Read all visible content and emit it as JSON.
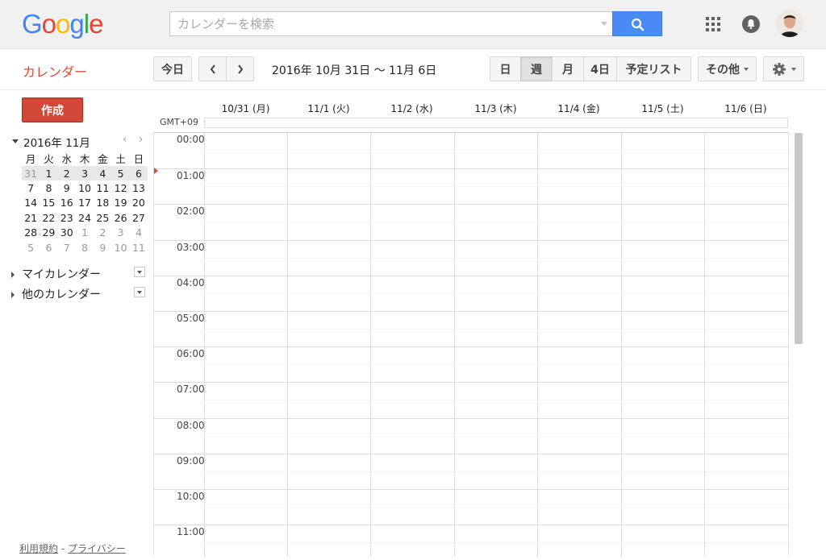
{
  "logo": {
    "text": "Google"
  },
  "search": {
    "placeholder": "カレンダーを検索"
  },
  "app": {
    "title": "カレンダー"
  },
  "toolbar": {
    "today_label": "今日",
    "prev": "‹",
    "next": "›",
    "date_range": "2016年 10月 31日 〜 11月 6日",
    "views": [
      "日",
      "週",
      "月",
      "4日",
      "予定リスト"
    ],
    "active_view": "週",
    "more_label": "その他",
    "settings_icon": "gear-icon"
  },
  "sidebar": {
    "create_label": "作成",
    "mini_month": "2016年 11月",
    "weekday_headers": [
      "月",
      "火",
      "水",
      "木",
      "金",
      "土",
      "日"
    ],
    "weeks": [
      [
        "31",
        "1",
        "2",
        "3",
        "4",
        "5",
        "6"
      ],
      [
        "7",
        "8",
        "9",
        "10",
        "11",
        "12",
        "13"
      ],
      [
        "14",
        "15",
        "16",
        "17",
        "18",
        "19",
        "20"
      ],
      [
        "21",
        "22",
        "23",
        "24",
        "25",
        "26",
        "27"
      ],
      [
        "28",
        "29",
        "30",
        "1",
        "2",
        "3",
        "4"
      ],
      [
        "5",
        "6",
        "7",
        "8",
        "9",
        "10",
        "11"
      ]
    ],
    "my_calendars": "マイカレンダー",
    "other_calendars": "他のカレンダー"
  },
  "grid": {
    "timezone": "GMT+09",
    "days": [
      "10/31 (月)",
      "11/1 (火)",
      "11/2 (水)",
      "11/3 (木)",
      "11/4 (金)",
      "11/5 (土)",
      "11/6 (日)"
    ],
    "hours": [
      "00:00",
      "01:00",
      "02:00",
      "03:00",
      "04:00",
      "05:00",
      "06:00",
      "07:00",
      "08:00",
      "09:00",
      "10:00",
      "11:00"
    ]
  },
  "footer": {
    "terms": "利用規約",
    "sep": " - ",
    "privacy": "プライバシー"
  },
  "colors": {
    "accent_red": "#dd4b39",
    "search_blue": "#4a8af4",
    "create_red": "#d14836"
  }
}
